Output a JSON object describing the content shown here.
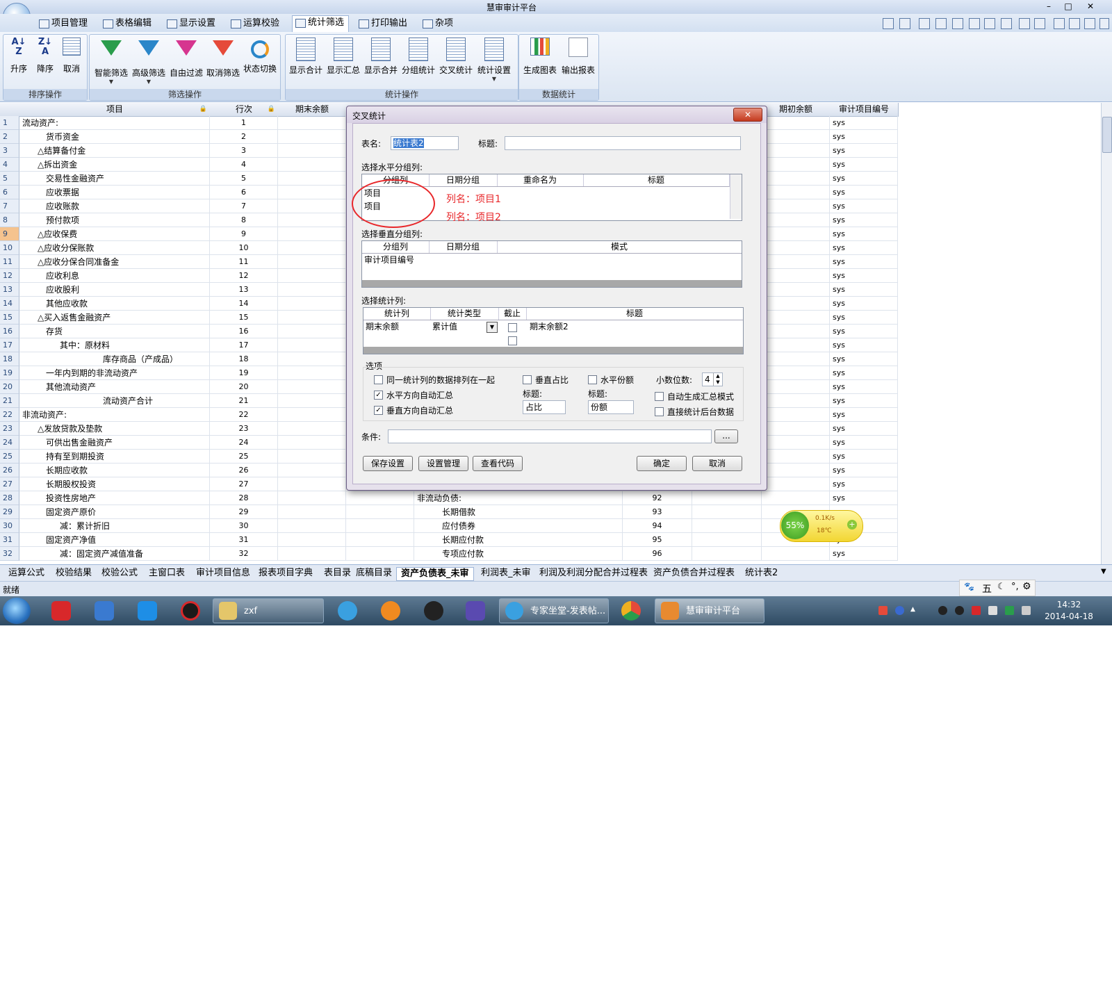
{
  "window": {
    "title": "慧审审计平台"
  },
  "menu_tabs": [
    "项目管理",
    "表格编辑",
    "显示设置",
    "运算校验",
    "统计筛选",
    "打印输出",
    "杂项"
  ],
  "ribbon": {
    "groups": [
      {
        "label": "排序操作",
        "buttons": [
          "升序",
          "降序",
          "取消"
        ]
      },
      {
        "label": "筛选操作",
        "buttons": [
          "智能筛选",
          "高级筛选",
          "自由过滤",
          "取消筛选",
          "状态切换"
        ]
      },
      {
        "label": "统计操作",
        "buttons": [
          "显示合计",
          "显示汇总",
          "显示合并",
          "分组统计",
          "交叉统计",
          "统计设置"
        ]
      },
      {
        "label": "数据统计",
        "buttons": [
          "生成图表",
          "输出报表"
        ]
      }
    ]
  },
  "sheet": {
    "headers": [
      "项目",
      "行次",
      "期末余额",
      "期初余额",
      "审计项目编号"
    ],
    "rows": [
      {
        "n": "1",
        "item": "流动资产:",
        "line": "1"
      },
      {
        "n": "2",
        "item": "货币资金",
        "line": "2"
      },
      {
        "n": "3",
        "item": "△结算备付金",
        "line": "3"
      },
      {
        "n": "4",
        "item": "△拆出资金",
        "line": "4"
      },
      {
        "n": "5",
        "item": "交易性金融资产",
        "line": "5"
      },
      {
        "n": "6",
        "item": "应收票据",
        "line": "6"
      },
      {
        "n": "7",
        "item": "应收账款",
        "line": "7"
      },
      {
        "n": "8",
        "item": "预付款项",
        "line": "8"
      },
      {
        "n": "9",
        "item": "△应收保费",
        "line": "9"
      },
      {
        "n": "10",
        "item": "△应收分保账款",
        "line": "10"
      },
      {
        "n": "11",
        "item": "△应收分保合同准备金",
        "line": "11"
      },
      {
        "n": "12",
        "item": "应收利息",
        "line": "12"
      },
      {
        "n": "13",
        "item": "应收股利",
        "line": "13"
      },
      {
        "n": "14",
        "item": "其他应收款",
        "line": "14"
      },
      {
        "n": "15",
        "item": "△买入返售金融资产",
        "line": "15"
      },
      {
        "n": "16",
        "item": "存货",
        "line": "16"
      },
      {
        "n": "17",
        "item": "其中：原材料",
        "line": "17"
      },
      {
        "n": "18",
        "item": "库存商品（产成品）",
        "line": "18"
      },
      {
        "n": "19",
        "item": "一年内到期的非流动资产",
        "line": "19"
      },
      {
        "n": "20",
        "item": "其他流动资产",
        "line": "20"
      },
      {
        "n": "21",
        "item": "流动资产合计",
        "line": "21"
      },
      {
        "n": "22",
        "item": "非流动资产:",
        "line": "22"
      },
      {
        "n": "23",
        "item": "△发放贷款及垫款",
        "line": "23"
      },
      {
        "n": "24",
        "item": "可供出售金融资产",
        "line": "24"
      },
      {
        "n": "25",
        "item": "持有至到期投资",
        "line": "25"
      },
      {
        "n": "26",
        "item": "长期应收款",
        "line": "26"
      },
      {
        "n": "27",
        "item": "长期股权投资",
        "line": "27"
      },
      {
        "n": "28",
        "item": "投资性房地产",
        "line": "28",
        "ritem": "非流动负债:",
        "rline": "92"
      },
      {
        "n": "29",
        "item": "固定资产原价",
        "line": "29",
        "ritem": "长期借款",
        "rline": "93"
      },
      {
        "n": "30",
        "item": "减：累计折旧",
        "line": "30",
        "ritem": "应付债券",
        "rline": "94"
      },
      {
        "n": "31",
        "item": "固定资产净值",
        "line": "31",
        "ritem": "长期应付款",
        "rline": "95"
      },
      {
        "n": "32",
        "item": "减：固定资产减值准备",
        "line": "32",
        "ritem": "专项应付款",
        "rline": "96"
      }
    ],
    "sys_value": "sys"
  },
  "sheet_tabs": [
    "运算公式",
    "校验结果",
    "校验公式",
    "主窗口表",
    "审计项目信息",
    "报表项目字典",
    "表目录",
    "底稿目录",
    "资产负债表_未审",
    "利润表_未审",
    "利润及利润分配合并过程表",
    "资产负债合并过程表",
    "统计表2"
  ],
  "status": "就绪",
  "dialog": {
    "title": "交叉统计",
    "table_name_label": "表名:",
    "table_name_value": "统计表2",
    "caption_label": "标题:",
    "caption_value": "",
    "horiz_label": "选择水平分组列:",
    "horiz_headers": [
      "分组列",
      "日期分组",
      "重命名为",
      "标题"
    ],
    "horiz_rows": [
      "项目",
      "项目"
    ],
    "annot": [
      "列名：项目1",
      "列名：项目2"
    ],
    "vert_label": "选择垂直分组列:",
    "vert_headers": [
      "分组列",
      "日期分组",
      "模式"
    ],
    "vert_rows": [
      "审计项目编号"
    ],
    "stat_label": "选择统计列:",
    "stat_headers": [
      "统计列",
      "统计类型",
      "截止",
      "标题"
    ],
    "stat_row": {
      "col": "期末余额",
      "type": "累计值",
      "title": "期末余额2"
    },
    "options_label": "选项",
    "opt_same": "同一统计列的数据排列在一起",
    "opt_h_total": "水平方向自动汇总",
    "opt_v_total": "垂直方向自动汇总",
    "opt_v_ratio": "垂直占比",
    "opt_h_share": "水平份额",
    "sub_title_label": "标题:",
    "ratio_title": "占比",
    "share_title": "份额",
    "decimals_label": "小数位数:",
    "decimals_value": "4",
    "opt_auto_mode": "自动生成汇总模式",
    "opt_direct": "直接统计后台数据",
    "condition_label": "条件:",
    "ellipsis": "...",
    "buttons": {
      "save": "保存设置",
      "manage": "设置管理",
      "code": "查看代码",
      "ok": "确定",
      "cancel": "取消"
    }
  },
  "taskbar": {
    "windows": [
      "zxf",
      "专家坐堂-发表帖...",
      "慧审审计平台"
    ],
    "time": "14:32",
    "date": "2014-04-18"
  },
  "net_widget": {
    "percent": "55%",
    "speed": "0.1K/s",
    "temp": "18℃"
  },
  "ime": {
    "label": "五"
  }
}
